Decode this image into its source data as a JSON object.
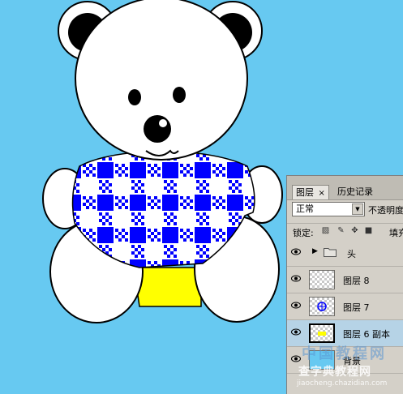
{
  "canvas": {
    "background": "#67c9f1"
  },
  "bear": {
    "shirt_colors": [
      "#0000ff",
      "#ffffff"
    ],
    "shorts_color": "#ffff00"
  },
  "layers_panel": {
    "tabs": [
      {
        "label": "图层",
        "active": true,
        "close": "×"
      },
      {
        "label": "历史记录",
        "active": false
      }
    ],
    "blend_mode": "正常",
    "opacity_label": "不透明度",
    "lock_label": "锁定:",
    "fill_label": "填充",
    "layers": [
      {
        "name": "头",
        "type": "group",
        "visible": true,
        "selected": false
      },
      {
        "name": "图层 8",
        "type": "layer",
        "visible": true,
        "selected": false
      },
      {
        "name": "图层 7",
        "type": "layer",
        "visible": true,
        "selected": false
      },
      {
        "name": "图层 6 副本",
        "type": "layer",
        "visible": true,
        "selected": true
      },
      {
        "name": "背景",
        "type": "layer",
        "visible": true,
        "selected": false
      }
    ]
  },
  "watermark": {
    "line1": "中国教程网",
    "line2": "查字典教程网",
    "line3": "jiaocheng.chazidian.com"
  }
}
